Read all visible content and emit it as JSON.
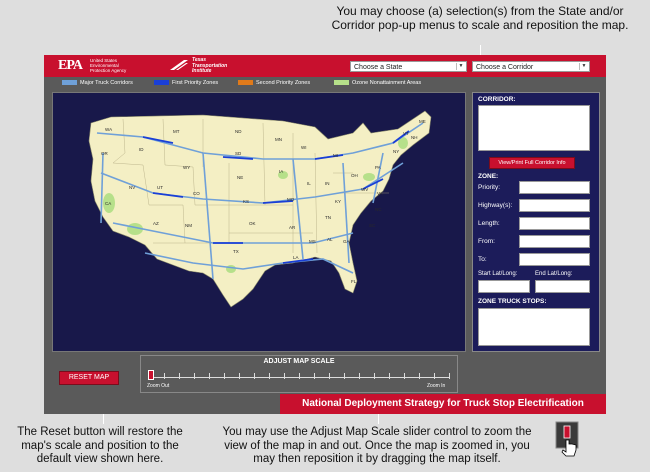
{
  "top_caption": "You may choose (a) selection(s) from the State and/or Corridor pop-up menus to scale and reposition the map.",
  "header": {
    "epa_logo": "EPA",
    "epa_subtitle": "United States Environmental Protection Agency",
    "tti_text": "Texas Transportation Institute",
    "state_select": "Choose a State",
    "corridor_select": "Choose a Corridor"
  },
  "legend": [
    {
      "label": "Major Truck Corridors",
      "color": "#6fa0d8"
    },
    {
      "label": "First Priority Zones",
      "color": "#1a3fd6"
    },
    {
      "label": "Second Priority Zones",
      "color": "#e07a1a"
    },
    {
      "label": "Ozone Nonattainment Areas",
      "color": "#b6e08a"
    }
  ],
  "map": {
    "land_color": "#f4efc4",
    "water_color": "#18184a",
    "state_labels": [
      "WA",
      "OR",
      "CA",
      "NV",
      "ID",
      "MT",
      "WY",
      "UT",
      "AZ",
      "NM",
      "CO",
      "ND",
      "SD",
      "NE",
      "KS",
      "OK",
      "TX",
      "MN",
      "IA",
      "MO",
      "AR",
      "LA",
      "WI",
      "IL",
      "MS",
      "MI",
      "IN",
      "KY",
      "TN",
      "AL",
      "OH",
      "GA",
      "FL",
      "SC",
      "NC",
      "VA",
      "WV",
      "PA",
      "NY",
      "ME",
      "VT",
      "NH"
    ]
  },
  "panel": {
    "corridor_title": "CORRIDOR:",
    "corridor_button": "View/Print Full Corridor Info",
    "zone_title": "ZONE:",
    "fields": [
      "Priority:",
      "Highway(s):",
      "Length:",
      "From:",
      "To:"
    ],
    "start_latlong": "Start Lat/Long:",
    "end_latlong": "End Lat/Long:",
    "stops_title": "ZONE TRUCK STOPS:"
  },
  "controls": {
    "reset_button": "RESET MAP",
    "scale_title": "ADJUST MAP SCALE",
    "zoom_out": "Zoom Out",
    "zoom_in": "Zoom In",
    "zoom_level": 0
  },
  "footer_title": "National Deployment Strategy for Truck Stop Electrification",
  "bottom_left_caption": "The Reset button will restore the map's scale and position to the default view shown here.",
  "bottom_mid_caption": "You may use the Adjust Map Scale slider control to zoom the view of the map in and out. Once the map is zoomed in, you may then reposition it by dragging the map itself."
}
